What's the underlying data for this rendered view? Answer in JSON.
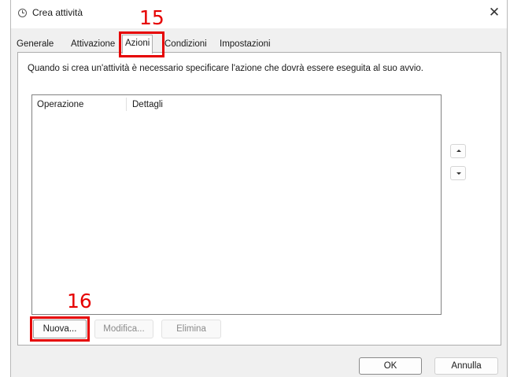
{
  "window": {
    "title": "Crea attività",
    "close_glyph": "✕"
  },
  "annotations": {
    "tab_step": "15",
    "button_step": "16",
    "color": "#e60000"
  },
  "tabs": [
    {
      "label": "Generale",
      "active": false
    },
    {
      "label": "Attivazione",
      "active": false
    },
    {
      "label": "Azioni",
      "active": true
    },
    {
      "label": "Condizioni",
      "active": false
    },
    {
      "label": "Impostazioni",
      "active": false
    }
  ],
  "actions_panel": {
    "description": "Quando si crea un'attività è necessario specificare l'azione che dovrà essere eseguita al suo avvio.",
    "columns": [
      "Operazione",
      "Dettagli"
    ],
    "rows": [],
    "move_up_icon": "arrow-up-icon",
    "move_down_icon": "arrow-down-icon"
  },
  "buttons": {
    "new": "Nuova...",
    "edit": "Modifica...",
    "delete": "Elimina",
    "ok": "OK",
    "cancel": "Annulla"
  }
}
